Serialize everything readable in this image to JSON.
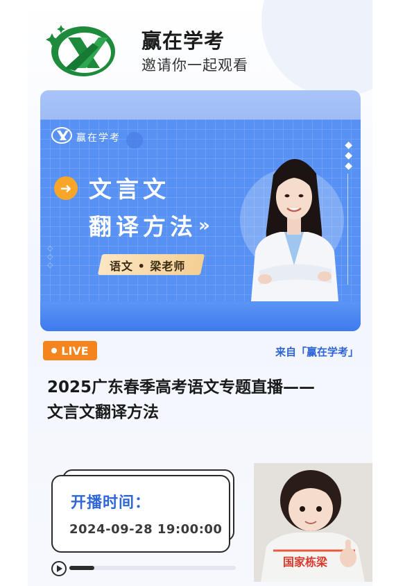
{
  "header": {
    "title": "赢在学考",
    "subtitle": "邀请你一起观看"
  },
  "banner": {
    "logo_text": "赢在学考",
    "title_line1": "文言文",
    "title_line2": "翻译方法",
    "chevrons": "»",
    "teacher_tag": "语文 • 梁老师"
  },
  "live": {
    "badge": "LIVE",
    "source": "来自「赢在学考」"
  },
  "main": {
    "title_line1": "2025广东春季高考语文专题直播——",
    "title_line2": "文言文翻译方法"
  },
  "schedule": {
    "label": "开播时间：",
    "time": "2024-09-28 19:00:00"
  },
  "player": {
    "progress": 0.15
  },
  "pip": {
    "shirt_text": "国家栋梁"
  },
  "colors": {
    "accent_blue": "#2f66d8",
    "live_orange": "#f4841e",
    "logo_green": "#1e8a3c"
  }
}
